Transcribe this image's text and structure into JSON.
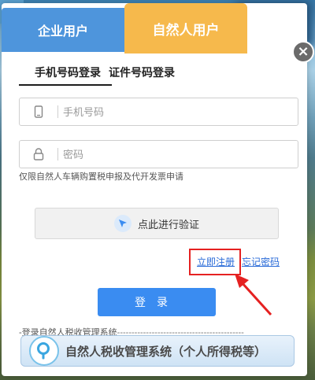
{
  "top_tabs": {
    "enterprise_label": "企业用户",
    "person_label": "自然人用户"
  },
  "login_tabs": [
    {
      "label": "手机号码登录"
    },
    {
      "label": "证件号码登录"
    }
  ],
  "form": {
    "phone_placeholder": "手机号码",
    "password_placeholder": "密码",
    "hint": "仅限自然人车辆购置税申报及代开发票申请"
  },
  "verify": {
    "label": "点此进行验证"
  },
  "links": {
    "register": "立即注册",
    "forgot": "忘记密码"
  },
  "login_button": "登录",
  "divider_label": "-登录自然人税收管理系统",
  "system_button": "自然人税收管理系统（个人所得税等）",
  "close_symbol": "×",
  "colors": {
    "enterprise_tab": "#4e95dc",
    "person_tab": "#f6b94c",
    "primary_button": "#3a8cf1",
    "link": "#2a6bd8",
    "highlight": "#e52121"
  }
}
